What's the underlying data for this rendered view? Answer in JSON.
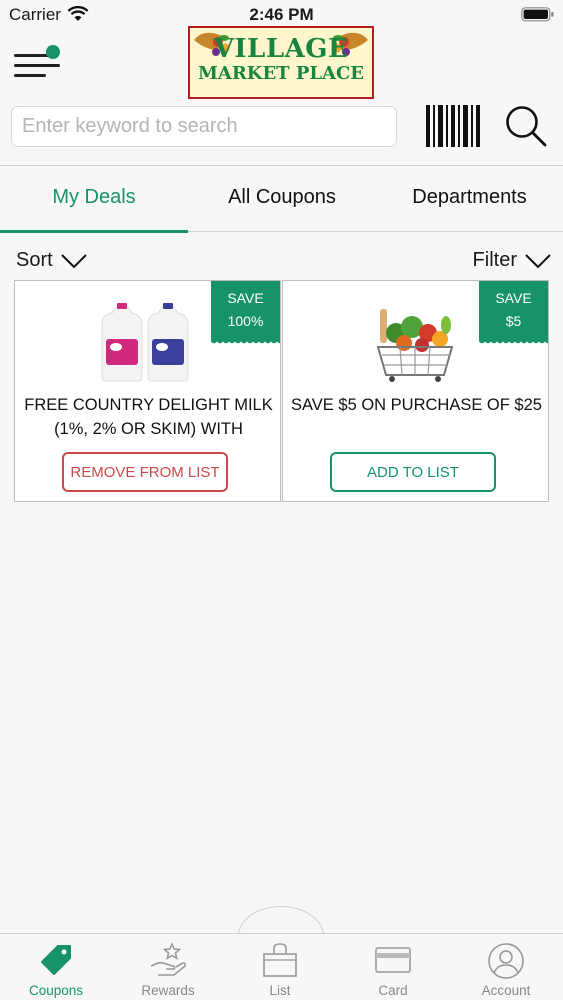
{
  "status_bar": {
    "carrier": "Carrier",
    "time": "2:46 PM"
  },
  "header": {
    "logo_line1": "VILLAGE",
    "logo_line2": "MARKET PLACE",
    "search_placeholder": "Enter keyword to search",
    "search_value": ""
  },
  "tabs": [
    {
      "label": "My Deals",
      "active": true
    },
    {
      "label": "All Coupons",
      "active": false
    },
    {
      "label": "Departments",
      "active": false
    }
  ],
  "toolbar": {
    "sort_label": "Sort",
    "filter_label": "Filter"
  },
  "deals": [
    {
      "badge_line1": "SAVE",
      "badge_line2": "100%",
      "title": "FREE COUNTRY DELIGHT MILK (1%, 2% OR SKIM) WITH",
      "button_label": "REMOVE FROM LIST",
      "image": "milk-jugs-image"
    },
    {
      "badge_line1": "SAVE",
      "badge_line2": "$5",
      "title": "SAVE $5 ON PURCHASE OF $25",
      "button_label": "ADD TO LIST",
      "image": "grocery-basket-image"
    }
  ],
  "bottom_nav": [
    {
      "label": "Coupons",
      "icon": "tag-icon",
      "active": true
    },
    {
      "label": "Rewards",
      "icon": "rewards-hand-star-icon",
      "active": false
    },
    {
      "label": "List",
      "icon": "shopping-bag-icon",
      "active": false
    },
    {
      "label": "Card",
      "icon": "card-icon",
      "active": false
    },
    {
      "label": "Account",
      "icon": "account-icon",
      "active": false
    }
  ],
  "colors": {
    "accent": "#17936b",
    "remove": "#cc4a4a",
    "logo_border": "#b51e1e",
    "logo_text": "#17853f"
  }
}
